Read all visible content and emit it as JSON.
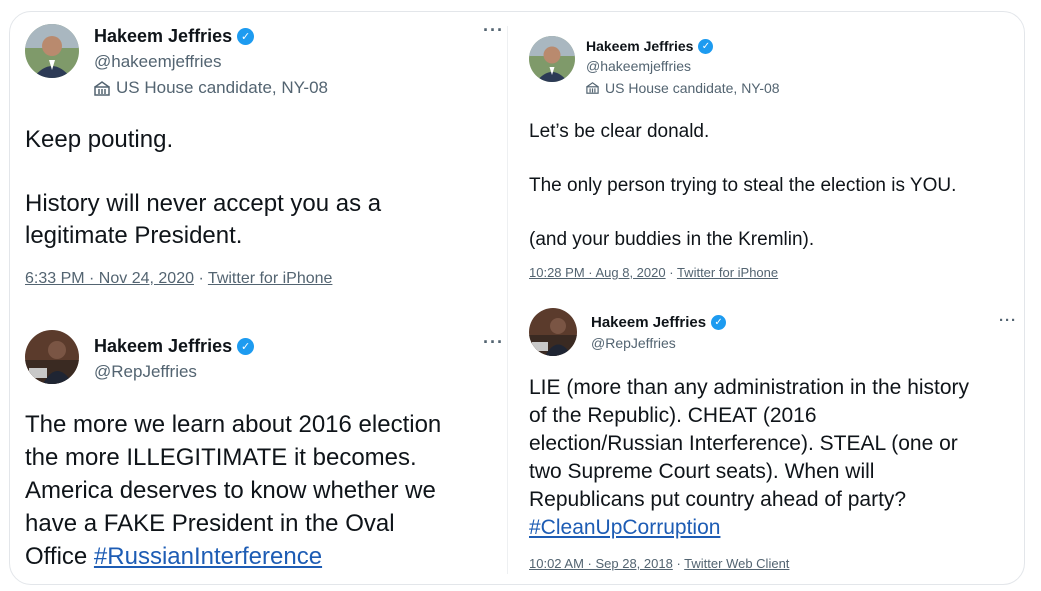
{
  "tweets": [
    {
      "name": "Hakeem Jeffries",
      "handle": "@hakeemjeffries",
      "label": "US House candidate, NY-08",
      "more": "···",
      "text": "Keep pouting.\n\nHistory will never accept you as a\nlegitimate President.",
      "hashtag": "",
      "time": "6:33 PM · Nov 24, 2020",
      "source": "Twitter for iPhone"
    },
    {
      "name": "Hakeem Jeffries",
      "handle": "@RepJeffries",
      "label": "",
      "more": "···",
      "text": "The more we learn about 2016 election\nthe more ILLEGITIMATE it becomes.\nAmerica deserves to know whether we\nhave a FAKE President in the Oval\nOffice ",
      "hashtag": "#RussianInterference",
      "time": "",
      "source": ""
    },
    {
      "name": "Hakeem Jeffries",
      "handle": "@hakeemjeffries",
      "label": "US House candidate, NY-08",
      "more": "",
      "text": "Let’s be clear donald.\n\nThe only person trying to steal the election is YOU.\n\n(and your buddies in the Kremlin).",
      "hashtag": "",
      "time": "10:28 PM · Aug 8, 2020",
      "source": "Twitter for iPhone"
    },
    {
      "name": "Hakeem Jeffries",
      "handle": "@RepJeffries",
      "label": "",
      "more": "···",
      "text": "LIE (more than any administration in the history\nof the Republic). CHEAT (2016\nelection/Russian Interference). STEAL (one or\ntwo Supreme Court seats). When will\nRepublicans put country ahead of party?\n",
      "hashtag": "#CleanUpCorruption",
      "time": "10:02 AM · Sep 28, 2018",
      "source": "Twitter Web Client"
    }
  ],
  "icons": {
    "verified": "verified-badge-icon",
    "label": "building-icon",
    "more": "more-options-icon"
  },
  "colors": {
    "verified": "#1d9bf0",
    "hashtag": "#1d5cb4",
    "secondary_text": "#536471",
    "primary_text": "#0f1419"
  }
}
